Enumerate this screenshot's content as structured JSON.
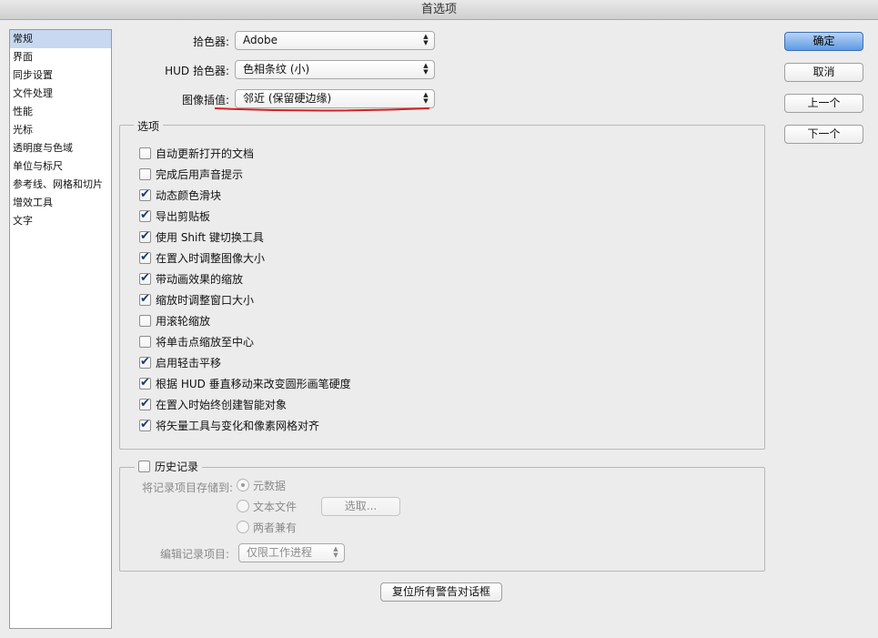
{
  "window": {
    "title": "首选项"
  },
  "sidebar": {
    "items": [
      {
        "label": "常规"
      },
      {
        "label": "界面"
      },
      {
        "label": "同步设置"
      },
      {
        "label": "文件处理"
      },
      {
        "label": "性能"
      },
      {
        "label": "光标"
      },
      {
        "label": "透明度与色域"
      },
      {
        "label": "单位与标尺"
      },
      {
        "label": "参考线、网格和切片"
      },
      {
        "label": "增效工具"
      },
      {
        "label": "文字"
      }
    ]
  },
  "settings": {
    "color_picker": {
      "label": "拾色器:",
      "value": "Adobe"
    },
    "hud_color_picker": {
      "label": "HUD 拾色器:",
      "value": "色相条纹 (小)"
    },
    "image_interpolation": {
      "label": "图像插值:",
      "value": "邻近 (保留硬边缘)"
    }
  },
  "options": {
    "title": "选项",
    "items": [
      {
        "label": "自动更新打开的文档",
        "checked": false
      },
      {
        "label": "完成后用声音提示",
        "checked": false
      },
      {
        "label": "动态颜色滑块",
        "checked": true
      },
      {
        "label": "导出剪贴板",
        "checked": true
      },
      {
        "label": "使用 Shift 键切换工具",
        "checked": true
      },
      {
        "label": "在置入时调整图像大小",
        "checked": true
      },
      {
        "label": "带动画效果的缩放",
        "checked": true
      },
      {
        "label": "缩放时调整窗口大小",
        "checked": true
      },
      {
        "label": "用滚轮缩放",
        "checked": false
      },
      {
        "label": "将单击点缩放至中心",
        "checked": false
      },
      {
        "label": "启用轻击平移",
        "checked": true
      },
      {
        "label": "根据 HUD 垂直移动来改变圆形画笔硬度",
        "checked": true
      },
      {
        "label": "在置入时始终创建智能对象",
        "checked": true
      },
      {
        "label": "将矢量工具与变化和像素网格对齐",
        "checked": true
      }
    ]
  },
  "history": {
    "title": "历史记录",
    "checked": false,
    "save_to_label": "将记录项目存储到:",
    "radios": [
      {
        "label": "元数据",
        "selected": true
      },
      {
        "label": "文本文件",
        "selected": false
      },
      {
        "label": "两者兼有",
        "selected": false
      }
    ],
    "choose_button": "选取...",
    "edit_log_label": "编辑记录项目:",
    "edit_log_value": "仅限工作进程"
  },
  "reset_warnings_button": "复位所有警告对话框",
  "buttons": {
    "ok": "确定",
    "cancel": "取消",
    "prev": "上一个",
    "next": "下一个"
  },
  "colors": {
    "accent": "#5d9ae4",
    "selection": "#c7d8f0",
    "annotation_red": "#d62020"
  }
}
